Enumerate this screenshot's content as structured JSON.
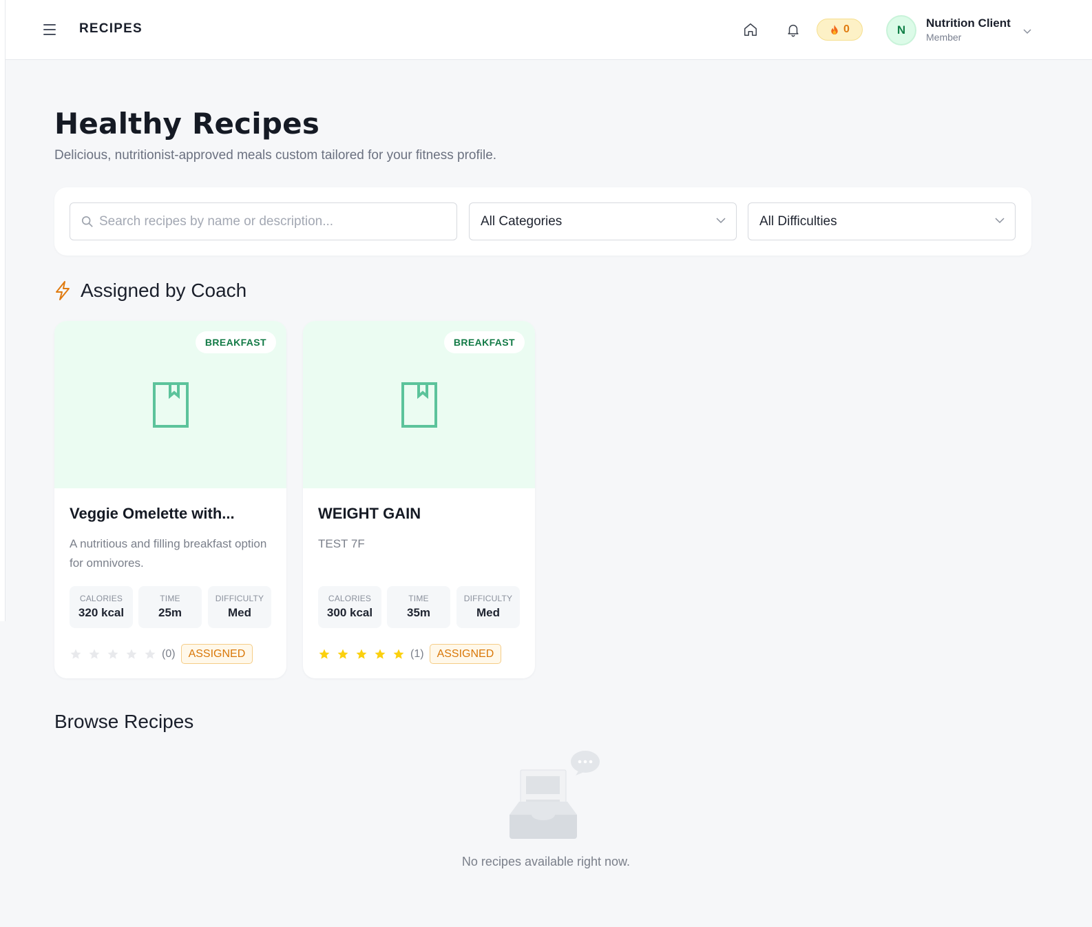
{
  "header": {
    "app_title": "RECIPES",
    "streak_count": "0",
    "user": {
      "initial": "N",
      "name": "Nutrition Client",
      "role": "Member"
    }
  },
  "page": {
    "title": "Healthy Recipes",
    "subtitle": "Delicious, nutritionist-approved meals custom tailored for your fitness profile."
  },
  "filters": {
    "search_placeholder": "Search recipes by name or description...",
    "category_value": "All Categories",
    "difficulty_value": "All Difficulties"
  },
  "assigned_section": {
    "title": "Assigned by Coach",
    "recipes": [
      {
        "category": "BREAKFAST",
        "title": "Veggie Omelette with...",
        "description": "A nutritious and filling breakfast option for omnivores.",
        "stats": [
          {
            "label": "CALORIES",
            "value": "320 kcal"
          },
          {
            "label": "TIME",
            "value": "25m"
          },
          {
            "label": "DIFFICULTY",
            "value": "Med"
          }
        ],
        "rating": 0,
        "rating_count": "(0)",
        "status": "ASSIGNED"
      },
      {
        "category": "BREAKFAST",
        "title": "WEIGHT GAIN",
        "description": "TEST 7F",
        "stats": [
          {
            "label": "CALORIES",
            "value": "300 kcal"
          },
          {
            "label": "TIME",
            "value": "35m"
          },
          {
            "label": "DIFFICULTY",
            "value": "Med"
          }
        ],
        "rating": 5,
        "rating_count": "(1)",
        "status": "ASSIGNED"
      }
    ]
  },
  "browse_section": {
    "title": "Browse Recipes",
    "empty_message": "No recipes available right now."
  },
  "colors": {
    "accent_green": "#127a46",
    "hero_bg": "#ebfcf2",
    "star_filled": "#fbd00e",
    "star_empty": "#e8e9ec",
    "assigned_orange": "#d97708"
  }
}
